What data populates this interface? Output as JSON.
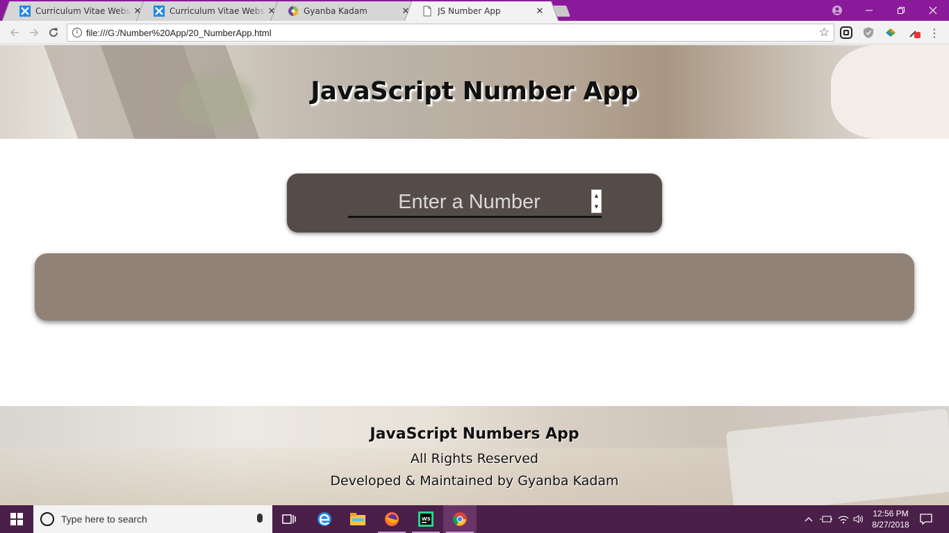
{
  "browser": {
    "tabs": [
      {
        "title": "Curriculum Vitae Website",
        "icon": "cv-icon",
        "active": false
      },
      {
        "title": "Curriculum Vitae Website",
        "icon": "cv-icon",
        "active": false
      },
      {
        "title": "Gyanba Kadam",
        "icon": "site-icon",
        "active": false
      },
      {
        "title": "JS Number App",
        "icon": "page-icon",
        "active": true
      }
    ],
    "url": "file:///G:/Number%20App/20_NumberApp.html"
  },
  "page": {
    "title": "JavaScript Number App",
    "number_input": {
      "placeholder": "Enter a Number",
      "value": ""
    },
    "result_text": ""
  },
  "footer": {
    "app_name": "JavaScript Numbers App",
    "rights": "All Rights Reserved",
    "credit": "Developed & Maintained by Gyanba Kadam"
  },
  "taskbar": {
    "search_placeholder": "Type here to search",
    "time": "12:56 PM",
    "date": "8/27/2018"
  },
  "colors": {
    "tab_strip": "#8b1a9b",
    "input_panel": "#554b49",
    "result_panel": "#918278",
    "taskbar": "#4a1f49"
  }
}
